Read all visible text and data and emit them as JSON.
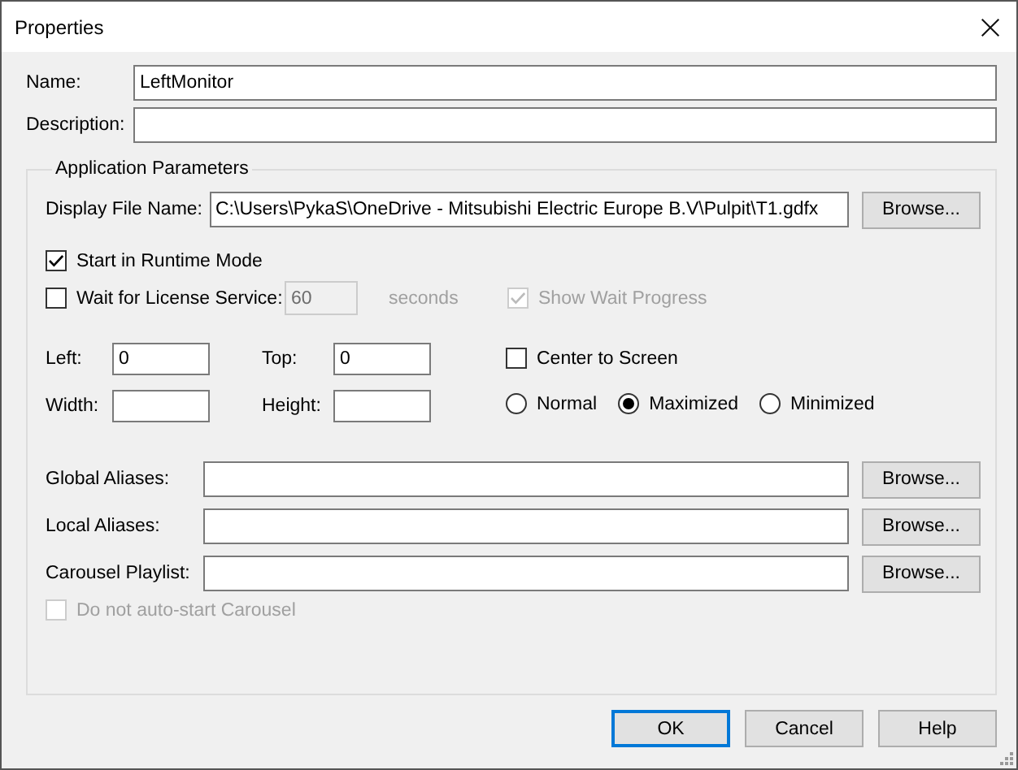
{
  "window": {
    "title": "Properties"
  },
  "fields": [
    {
      "label": "Name:",
      "value": "LeftMonitor"
    },
    {
      "label": "Description:"
    }
  ],
  "application_parameters": {
    "title": "Application Parameters",
    "display_file": {
      "label": "Display File Name:",
      "value": "C:\\Users\\PykaS\\OneDrive - Mitsubishi Electric Europe B.V\\Pulpit\\T1.gdfx",
      "button": "Browse..."
    },
    "start_in_runtime": {
      "label": "Start in Runtime Mode",
      "checked": true,
      "disabled": false
    },
    "wait_for_license": {
      "label": "Wait for License Service:",
      "checked": false,
      "disabled": false
    },
    "timeout": {
      "value": "60",
      "unit": "seconds",
      "disabled": true
    },
    "show_wait_progress": {
      "label": "Show Wait Progress",
      "checked": true,
      "disabled": true
    },
    "position": [
      {
        "label": "Left:",
        "value": "0"
      },
      {
        "label": "Top:",
        "value": "0"
      },
      {
        "label": "Width:"
      },
      {
        "label": "Height:"
      }
    ],
    "center_to_screen": {
      "label": "Center to Screen",
      "checked": false,
      "disabled": false
    },
    "window_state": [
      {
        "label": "Normal",
        "selected": false
      },
      {
        "label": "Maximized",
        "selected": true
      },
      {
        "label": "Minimized",
        "selected": false
      }
    ],
    "paths": [
      {
        "label": "Global Aliases:",
        "button": "Browse..."
      },
      {
        "label": "Local Aliases:",
        "button": "Browse..."
      },
      {
        "label": "Carousel Playlist:",
        "button": "Browse..."
      }
    ],
    "no_autostart_carousel": {
      "label": "Do not auto-start Carousel",
      "checked": false,
      "disabled": true
    }
  },
  "buttons": [
    {
      "label": "OK",
      "default": true
    },
    {
      "label": "Cancel",
      "default": false
    },
    {
      "label": "Help",
      "default": false
    }
  ]
}
